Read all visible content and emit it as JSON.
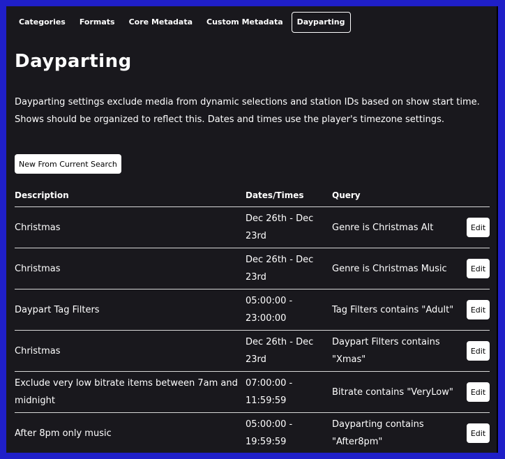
{
  "tabs": [
    {
      "label": "Categories"
    },
    {
      "label": "Formats"
    },
    {
      "label": "Core Metadata"
    },
    {
      "label": "Custom Metadata"
    },
    {
      "label": "Dayparting",
      "active": true
    }
  ],
  "page": {
    "title": "Dayparting",
    "description": "Dayparting settings exclude media from dynamic selections and station IDs based on show start time. Shows should be organized to reflect this. Dates and times use the player's timezone settings.",
    "new_button": "New From Current Search"
  },
  "table": {
    "headers": {
      "description": "Description",
      "dates": "Dates/Times",
      "query": "Query"
    },
    "edit_label": "Edit",
    "rows": [
      {
        "description": "Christmas",
        "dates": "Dec 26th - Dec 23rd",
        "query": "Genre is Christmas Alt"
      },
      {
        "description": "Christmas",
        "dates": "Dec 26th - Dec 23rd",
        "query": "Genre is Christmas Music"
      },
      {
        "description": "Daypart Tag Filters",
        "dates": "05:00:00 - 23:00:00",
        "query": "Tag Filters contains \"Adult\""
      },
      {
        "description": "Christmas",
        "dates": "Dec 26th - Dec 23rd",
        "query": "Daypart Filters contains \"Xmas\""
      },
      {
        "description": "Exclude very low bitrate items between 7am and midnight",
        "dates": "07:00:00 - 11:59:59",
        "query": "Bitrate contains \"VeryLow\""
      },
      {
        "description": "After 8pm only music",
        "dates": "05:00:00 - 19:59:59",
        "query": "Dayparting contains \"After8pm\""
      }
    ]
  },
  "colors": {
    "frame": "#1f1fc8",
    "panel": "#19181d",
    "button": "#ffffff"
  }
}
